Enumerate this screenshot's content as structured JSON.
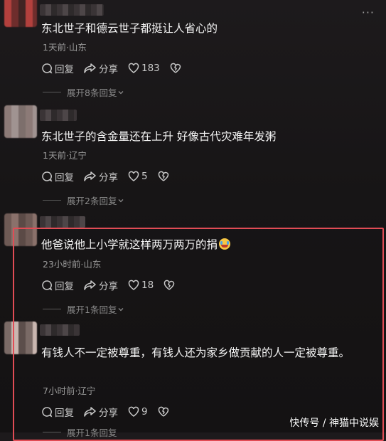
{
  "comments": [
    {
      "text": "东北世子和德云世子都挺让人省心的",
      "meta": "1天前·山东",
      "reply": "回复",
      "share": "分享",
      "likes": "183",
      "expand": "展开8条回复"
    },
    {
      "text": "东北世子的含金量还在上升 好像古代灾难年发粥",
      "meta": "1天前·辽宁",
      "reply": "回复",
      "share": "分享",
      "likes": "5",
      "expand": "展开2条回复"
    },
    {
      "text": "他爸说他上小学就这样两万两万的捐",
      "meta": "23小时前·山东",
      "reply": "回复",
      "share": "分享",
      "likes": "18",
      "expand": "展开1条回复"
    },
    {
      "text": "有钱人不一定被尊重，有钱人还为家乡做贡献的人一定被尊重。",
      "meta": "7小时前·辽宁",
      "reply": "回复",
      "share": "分享",
      "likes": "9",
      "expand": "展开1条回复"
    }
  ],
  "watermark": "快传号 / 神猫中说娱",
  "colors": {
    "highlight": "#e14c55",
    "background": "#171516"
  }
}
